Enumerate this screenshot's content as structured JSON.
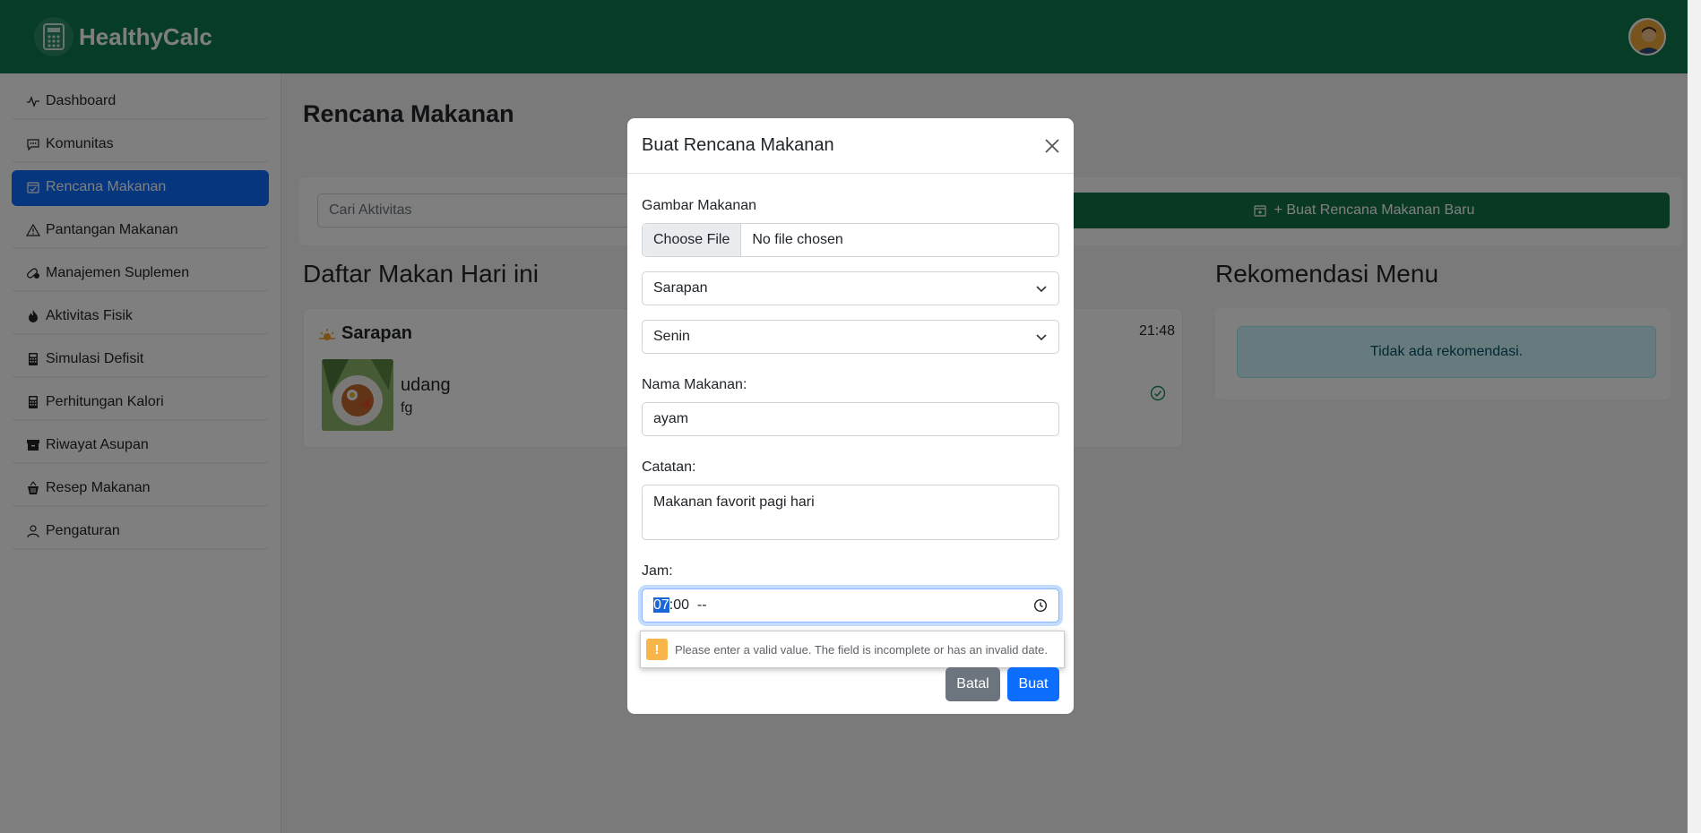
{
  "header": {
    "brand": "HealthyCalc"
  },
  "sidebar": {
    "items": [
      {
        "label": "Dashboard",
        "icon": "activity-icon",
        "active": false
      },
      {
        "label": "Komunitas",
        "icon": "chat-icon",
        "active": false
      },
      {
        "label": "Rencana Makanan",
        "icon": "calendar-check-icon",
        "active": true
      },
      {
        "label": "Pantangan Makanan",
        "icon": "warning-icon",
        "active": false
      },
      {
        "label": "Manajemen Suplemen",
        "icon": "capsule-icon",
        "active": false
      },
      {
        "label": "Aktivitas Fisik",
        "icon": "fire-icon",
        "active": false
      },
      {
        "label": "Simulasi Defisit",
        "icon": "calculator-icon",
        "active": false
      },
      {
        "label": "Perhitungan Kalori",
        "icon": "calculator-icon",
        "active": false
      },
      {
        "label": "Riwayat Asupan",
        "icon": "archive-icon",
        "active": false
      },
      {
        "label": "Resep Makanan",
        "icon": "basket-icon",
        "active": false
      },
      {
        "label": "Pengaturan",
        "icon": "person-icon",
        "active": false
      }
    ]
  },
  "main": {
    "title": "Rencana Makanan",
    "search_placeholder": "Cari Aktivitas",
    "new_plan_button": "+ Buat Rencana Makanan Baru",
    "daily_title": "Daftar Makan Hari ini",
    "meal": {
      "type": "Sarapan",
      "time": "21:48",
      "name": "udang",
      "note": "fg"
    },
    "recommend_title": "Rekomendasi Menu",
    "recommend_empty": "Tidak ada rekomendasi."
  },
  "modal": {
    "title": "Buat Rencana Makanan",
    "image_label": "Gambar Makanan",
    "file_button": "Choose File",
    "file_status": "No file chosen",
    "meal_type": "Sarapan",
    "day": "Senin",
    "food_name_label": "Nama Makanan:",
    "food_name_value": "ayam",
    "note_label": "Catatan:",
    "note_value": "Makanan favorit pagi hari",
    "time_label": "Jam:",
    "time_hour": "07",
    "time_rest": ":00  --",
    "validation_message": "Please enter a valid value. The field is incomplete or has an invalid date.",
    "cancel_button": "Batal",
    "create_button": "Buat"
  },
  "colors": {
    "header_green": "#0f7a4f",
    "primary": "#0d6efd",
    "success": "#157347",
    "secondary": "#6c757d",
    "info_bg": "#cff4fc"
  }
}
